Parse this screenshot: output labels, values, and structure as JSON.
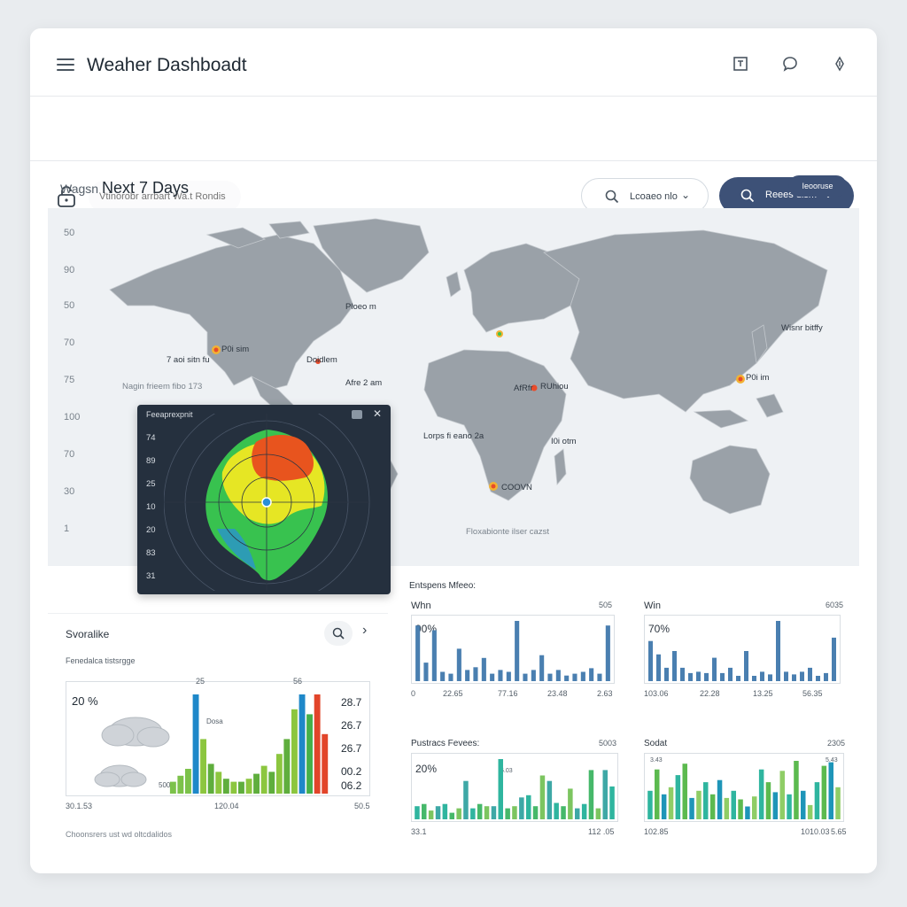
{
  "app": {
    "title": "Weaher Dashboadt"
  },
  "search": {
    "placeholder": "Vtinorobr arrbart Wa.t Rondis"
  },
  "filters": {
    "location_label": "Lcoaeo nlo",
    "primary_label": "Reees dism"
  },
  "section": {
    "prefix": "Wagsn",
    "title": "Next 7 Days",
    "badge": "Ieooruse"
  },
  "map": {
    "y_axis": [
      "50",
      "90",
      "50",
      "70",
      "75",
      "100",
      "70",
      "30",
      "1"
    ],
    "labels": {
      "north_america_1": "7 aoi sitn fu",
      "north_america_2": "P0i sim",
      "north_america_3": "Doidlem",
      "north_america_4": "Afre 2 am",
      "canada": "Ploeo m",
      "left_caption": "Nagin frieem fibo 173",
      "africa_1": "AfRfr",
      "africa_2": "RUhiou",
      "africa_3": "Lorps fi eano 2a",
      "africa_4": "I0i otm",
      "africa_5": "COOVN",
      "asia_1": "Wisnr bitffy",
      "asia_2": "P0i im",
      "bottom_caption": "Floxabionte ilser cazst"
    },
    "markers": {
      "hot": "#e94b2a",
      "warm": "#f2b233",
      "cold": "#4a90d9"
    }
  },
  "radar": {
    "title": "Feeaprexpnit",
    "y_axis": [
      "74",
      "89",
      "25",
      "10",
      "20",
      "83",
      "31"
    ],
    "colors": {
      "hot": "#e8541e",
      "warm": "#e6e624",
      "cool": "#38c24f",
      "cold": "#2a8fd6"
    }
  },
  "left_panel": {
    "title": "Svoralike",
    "subtitle": "Fenedalca tistsrgge",
    "footer": "Choonsrers ust wd oltcdalidos",
    "chart": {
      "percent": "20 %",
      "side_values": [
        "28.7",
        "26.7",
        "26.7",
        "00.2",
        "06.2"
      ],
      "top_labels": [
        "25",
        "56"
      ],
      "inner_label": "Dosa",
      "x_labels": [
        "30.1.53",
        "120.04",
        "50.5"
      ],
      "left_label": "500"
    }
  },
  "mini_section": {
    "title": "Entspens Mfeeo:",
    "row2_left_title": "Pustracs Fevees:",
    "row2_right_title": "Sodat"
  },
  "mini_charts": [
    {
      "title": "Whn",
      "corner": "505",
      "percent": "90%",
      "x_labels": [
        "0",
        "22.65",
        "77.16",
        "23.48",
        "2.63"
      ]
    },
    {
      "title": "Win",
      "corner": "6035",
      "percent": "70%",
      "x_labels": [
        "103.06",
        "22.28",
        "13.25",
        "56.35"
      ]
    },
    {
      "title": "",
      "corner": "5003",
      "percent": "20%",
      "x_labels": [
        "33.1",
        "112 .05"
      ],
      "peak_label": "5.03"
    },
    {
      "title": "",
      "corner": "2305",
      "percent": "",
      "x_labels": [
        "102.85",
        "1010.03",
        "5.65"
      ],
      "peak_left": "3.43",
      "peak_right": "5.43"
    }
  ],
  "chart_data": [
    {
      "type": "bar",
      "title": "Svoralike",
      "series": [
        {
          "values": [
            12,
            18,
            25,
            100,
            55,
            30,
            22,
            15,
            12,
            12,
            15,
            20,
            28,
            22,
            40,
            55,
            85,
            100,
            80,
            100,
            60
          ]
        }
      ],
      "ylim": [
        0,
        100
      ]
    },
    {
      "type": "bar",
      "title": "Whn",
      "series": [
        {
          "values": [
            60,
            20,
            55,
            10,
            8,
            35,
            12,
            15,
            25,
            8,
            12,
            10,
            65,
            8,
            12,
            28,
            8,
            12,
            6,
            8,
            10,
            14,
            8,
            60
          ]
        }
      ]
    },
    {
      "type": "bar",
      "title": "Win",
      "series": [
        {
          "values": [
            60,
            40,
            20,
            45,
            20,
            12,
            14,
            12,
            35,
            12,
            20,
            8,
            45,
            8,
            14,
            10,
            90,
            14,
            10,
            14,
            20,
            8,
            12,
            65
          ]
        }
      ]
    },
    {
      "type": "bar",
      "title": "Pustracs Fevees:",
      "series": [
        {
          "values": [
            12,
            14,
            8,
            12,
            14,
            6,
            10,
            35,
            10,
            14,
            12,
            12,
            55,
            10,
            12,
            20,
            22,
            12,
            40,
            35,
            15,
            12,
            28,
            10,
            14,
            45,
            10,
            45,
            30
          ]
        }
      ]
    },
    {
      "type": "bar",
      "title": "Sodat",
      "series": [
        {
          "values": [
            40,
            70,
            35,
            45,
            62,
            78,
            30,
            40,
            52,
            35,
            55,
            30,
            40,
            28,
            18,
            32,
            70,
            52,
            38,
            68,
            35,
            82,
            40,
            20,
            52,
            75,
            80,
            45
          ]
        }
      ]
    }
  ]
}
